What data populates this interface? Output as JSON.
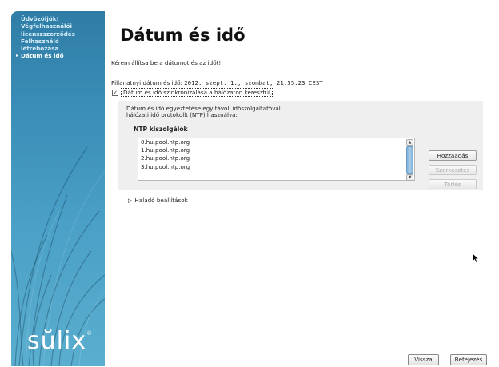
{
  "sidebar": {
    "items": [
      {
        "label": "Üdvözöljük!"
      },
      {
        "label": "Végfelhasználói"
      },
      {
        "label": "licenszszerződés"
      },
      {
        "label": "Felhasználó"
      },
      {
        "label": "létrehozása"
      },
      {
        "label": "Dátum és idő"
      }
    ],
    "active_arrow": "▸",
    "logo": "sŭlix",
    "logo_mark": "®"
  },
  "main": {
    "title": "Dátum és idő",
    "intro": "Kérem állítsa be a dátumot és az időt!",
    "current_label": "Pillanatnyi dátum és idő:",
    "current_value": "2012. szept.  1., szombat, 21.55.23 CEST",
    "sync_checkbox": {
      "checked": true,
      "mark": "✓",
      "label": "Dátum és idő szinkronizálása a hálózaton keresztül"
    },
    "description_line1": "Dátum és idő egyeztetése egy távoli időszolgáltatóval",
    "description_line2": "hálózati idő protokollt (NTP) használva:",
    "ntp_heading": "NTP kiszolgálók",
    "servers": [
      "0.hu.pool.ntp.org",
      "1.hu.pool.ntp.org",
      "2.hu.pool.ntp.org",
      "3.hu.pool.ntp.org"
    ],
    "buttons": {
      "add": "Hozzáadás",
      "edit": "Szerkesztés",
      "delete": "Törlés"
    },
    "advanced": "Haladó beállítások",
    "advanced_icon": "▷"
  },
  "footer": {
    "back": "Vissza",
    "finish": "Befejezés"
  },
  "colors": {
    "sidebar_top": "#2f7da7",
    "sidebar_bottom": "#5aaecf",
    "panel": "#efefef"
  }
}
